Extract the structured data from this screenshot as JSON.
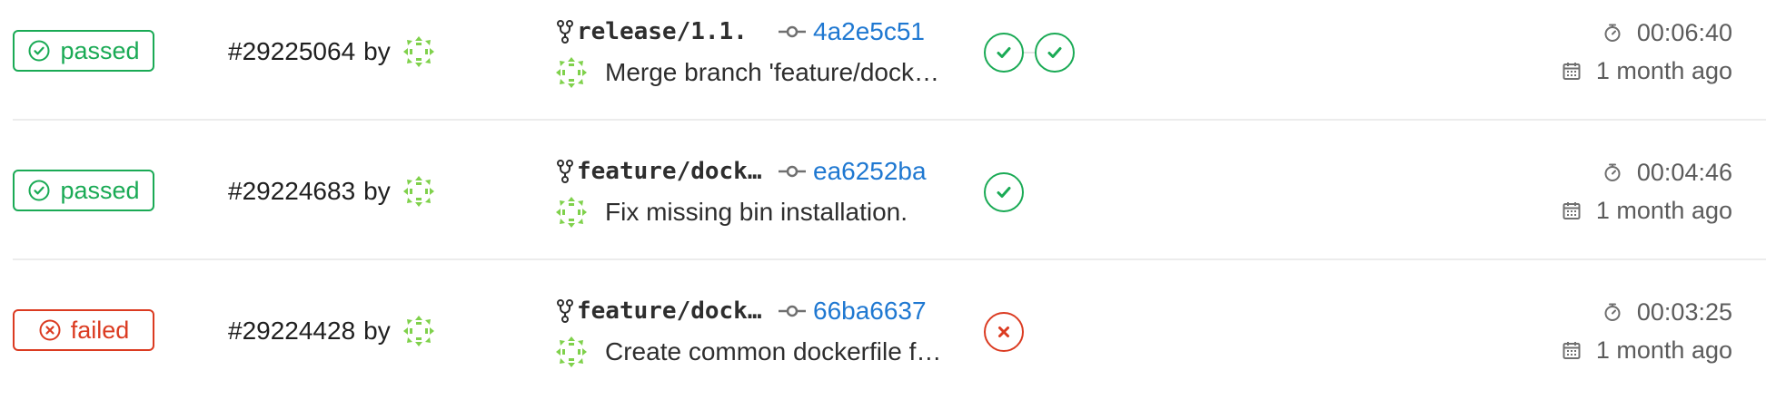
{
  "colors": {
    "success": "#1aaa55",
    "failed": "#db3b21",
    "link": "#1f78d1"
  },
  "rows": [
    {
      "status": "passed",
      "status_kind": "success",
      "pipeline_id": "#29225064",
      "by": "by",
      "branch": "release/1.1.",
      "commit_sha": "4a2e5c51",
      "commit_title": "Merge branch 'feature/docker-common'",
      "stages": [
        "success",
        "success"
      ],
      "duration": "00:06:40",
      "finished": "1 month ago"
    },
    {
      "status": "passed",
      "status_kind": "success",
      "pipeline_id": "#29224683",
      "by": "by",
      "branch": "feature/docker-common",
      "commit_sha": "ea6252ba",
      "commit_title": "Fix missing bin installation.",
      "stages": [
        "success"
      ],
      "duration": "00:04:46",
      "finished": "1 month ago"
    },
    {
      "status": "failed",
      "status_kind": "failed",
      "pipeline_id": "#29224428",
      "by": "by",
      "branch": "feature/docker-common",
      "commit_sha": "66ba6637",
      "commit_title": "Create common dockerfile for images",
      "stages": [
        "failed"
      ],
      "duration": "00:03:25",
      "finished": "1 month ago"
    }
  ],
  "icons": {
    "status_success": "check-circle-icon",
    "status_failed": "close-circle-icon",
    "branch": "fork-icon",
    "commit": "commit-icon",
    "avatar": "identicon-avatar",
    "stage_success": "check-icon",
    "stage_failed": "close-icon",
    "duration": "timer-icon",
    "finished": "calendar-icon"
  }
}
